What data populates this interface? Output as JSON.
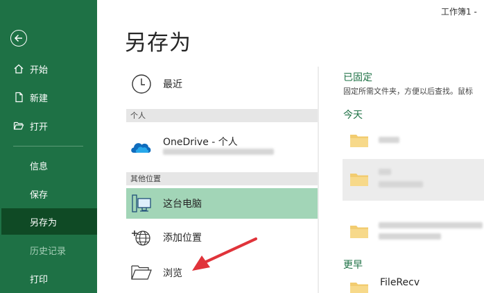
{
  "window": {
    "title": "工作簿1  -"
  },
  "sidebar": {
    "back_icon": "arrow-left-icon",
    "items": [
      {
        "label": "开始",
        "icon": "home-icon"
      },
      {
        "label": "新建",
        "icon": "new-file-icon"
      },
      {
        "label": "打开",
        "icon": "open-folder-icon"
      },
      {
        "label": "信息"
      },
      {
        "label": "保存"
      },
      {
        "label": "另存为",
        "active": true
      },
      {
        "label": "历史记录",
        "dim": true
      },
      {
        "label": "打印"
      }
    ]
  },
  "main": {
    "title": "另存为",
    "recent": {
      "label": "最近",
      "icon": "clock-icon"
    },
    "group_personal": "个人",
    "onedrive": {
      "label": "OneDrive - 个人",
      "icon": "onedrive-cloud-icon"
    },
    "group_other": "其他位置",
    "this_pc": {
      "label": "这台电脑",
      "icon": "computer-icon",
      "selected": true
    },
    "add_place": {
      "label": "添加位置",
      "icon": "globe-plus-icon"
    },
    "browse": {
      "label": "浏览",
      "icon": "folder-open-icon"
    }
  },
  "pinned": {
    "header": "已固定",
    "description": "固定所需文件夹，方便以后查找。鼠标",
    "today_header": "今天",
    "earlier_header": "更早",
    "earlier_folder": "FileRecv"
  },
  "colors": {
    "sidebar_bg": "#1e7145",
    "sidebar_active": "#0f4a25",
    "selected_location": "#a2d5b7",
    "accent_text": "#1e7145",
    "annotation_arrow": "#e0333a"
  }
}
